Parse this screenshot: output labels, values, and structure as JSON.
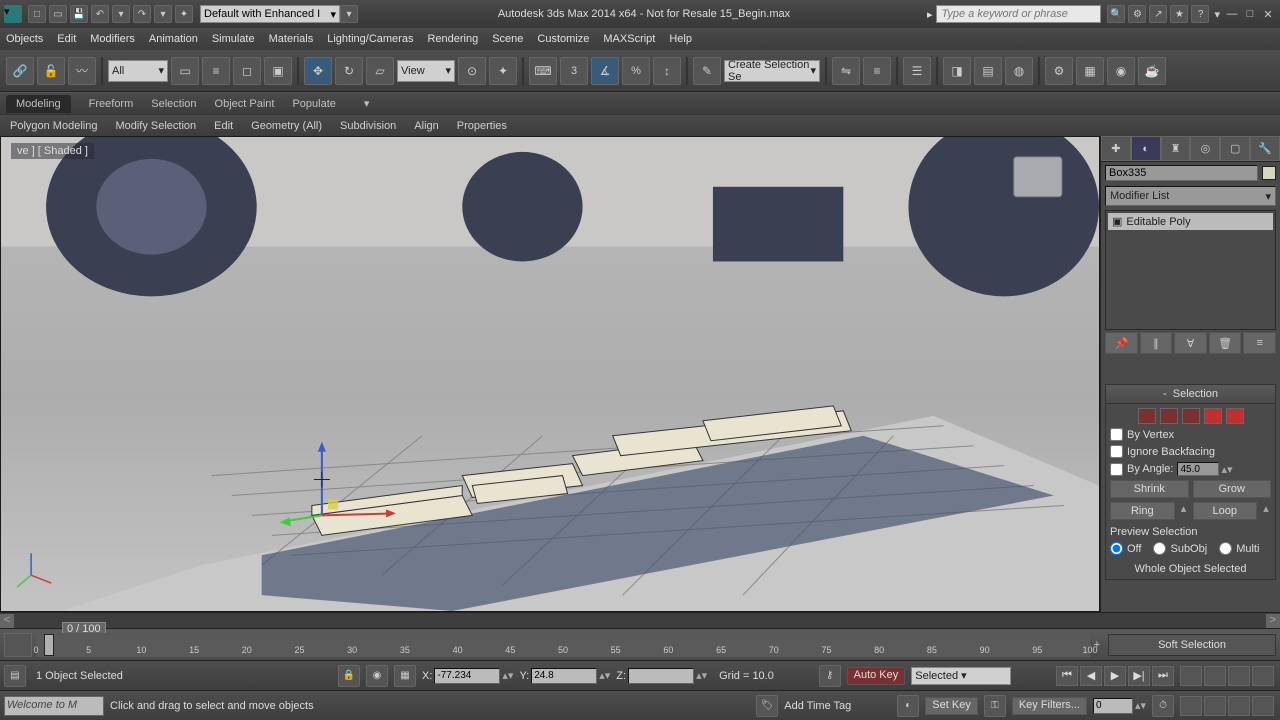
{
  "workspace": "Default with Enhanced I",
  "title": "Autodesk 3ds Max  2014 x64 - Not for Resale   15_Begin.max",
  "search_placeholder": "Type a keyword or phrase",
  "menus": [
    "Objects",
    "Edit",
    "Modifiers",
    "Animation",
    "Simulate",
    "Materials",
    "Lighting/Cameras",
    "Rendering",
    "Scene",
    "Customize",
    "MAXScript",
    "Help"
  ],
  "toolbar": {
    "selection_filter": "All",
    "ref_coord": "View",
    "snap_label": "3",
    "percent_label": "%"
  },
  "ribbon": {
    "tabs": [
      "Modeling",
      "Freeform",
      "Selection",
      "Object Paint",
      "Populate"
    ],
    "panels": [
      "Polygon Modeling",
      "Modify Selection",
      "Edit",
      "Geometry (All)",
      "Subdivision",
      "Align",
      "Properties"
    ]
  },
  "viewport_label": "[ + ] [ Perspective ] [ Shaded ]",
  "viewport_label_short": "ve ] [ Shaded ]",
  "cmd_panel": {
    "object_name": "Box335",
    "modifier_list": "Modifier List",
    "stack_item": "Editable Poly",
    "selection": {
      "title": "Selection",
      "by_vertex": "By Vertex",
      "ignore_backfacing": "Ignore Backfacing",
      "by_angle": "By Angle:",
      "angle_val": "45.0",
      "shrink": "Shrink",
      "grow": "Grow",
      "ring": "Ring",
      "loop": "Loop",
      "preview": "Preview Selection",
      "off": "Off",
      "subobj": "SubObj",
      "multi": "Multi",
      "status": "Whole Object Selected"
    },
    "soft_selection": "Soft Selection"
  },
  "timeslider": {
    "label": "0 / 100"
  },
  "track_ticks": [
    0,
    5,
    10,
    15,
    20,
    25,
    30,
    35,
    40,
    45,
    50,
    55,
    60,
    65,
    70,
    75,
    80,
    85,
    90,
    95,
    100
  ],
  "status": {
    "sel_info": "1 Object Selected",
    "x": "-77.234",
    "y": "24.8",
    "z": "",
    "grid": "Grid = 10.0",
    "auto_key": "Auto Key",
    "set_key": "Set Key",
    "key_mode": "Selected",
    "key_filters": "Key Filters...",
    "prompt": "Welcome to M",
    "hint": "Click and drag to select and move objects",
    "add_time_tag": "Add Time Tag"
  }
}
